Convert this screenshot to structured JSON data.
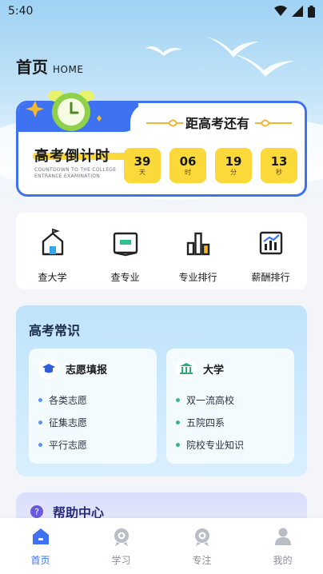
{
  "status_bar": {
    "time": "5:40",
    "icons": [
      "wifi-icon",
      "signal-icon",
      "battery-icon"
    ]
  },
  "header": {
    "title": "首页",
    "subtitle": "HOME"
  },
  "countdown": {
    "subtitle": "距高考还有",
    "title": "高考倒计时",
    "caption": "COUNTDOWN TO THE COLLEGE ENTRANCE EXAMINATION",
    "units": [
      {
        "value": "39",
        "label": "天"
      },
      {
        "value": "06",
        "label": "时"
      },
      {
        "value": "19",
        "label": "分"
      },
      {
        "value": "13",
        "label": "秒"
      }
    ],
    "accent": "#3f72f0",
    "highlight": "#fbd93b"
  },
  "tools": [
    {
      "label": "查大学",
      "icon": "university-icon"
    },
    {
      "label": "查专业",
      "icon": "book-icon"
    },
    {
      "label": "专业排行",
      "icon": "ranking-chart-icon"
    },
    {
      "label": "薪酬排行",
      "icon": "salary-chart-icon"
    }
  ],
  "knowledge": {
    "title": "高考常识",
    "cards": [
      {
        "title": "志愿填报",
        "icon": "graduation-cap-icon",
        "items": [
          "各类志愿",
          "征集志愿",
          "平行志愿"
        ]
      },
      {
        "title": "大学",
        "icon": "university-building-icon",
        "items": [
          "双一流高校",
          "五院四系",
          "院校专业知识"
        ]
      }
    ]
  },
  "help": {
    "title": "帮助中心",
    "icon": "question-icon"
  },
  "tabbar": [
    {
      "label": "首页",
      "icon": "home-icon",
      "active": true
    },
    {
      "label": "学习",
      "icon": "study-icon",
      "active": false
    },
    {
      "label": "专注",
      "icon": "focus-icon",
      "active": false
    },
    {
      "label": "我的",
      "icon": "profile-icon",
      "active": false
    }
  ]
}
